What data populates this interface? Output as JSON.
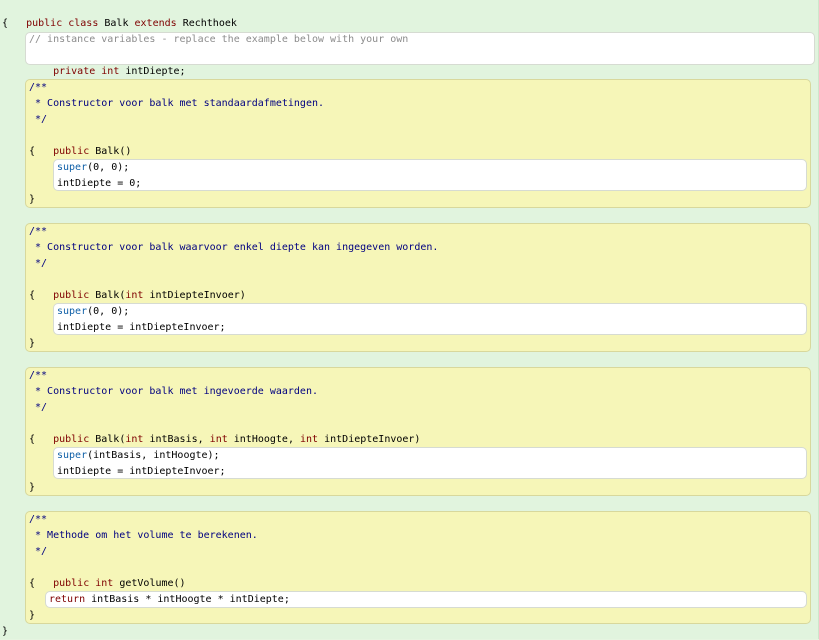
{
  "class_header": {
    "public": "public",
    "class": "class",
    "name": "Balk",
    "extends": "extends",
    "parent": "Rechthoek",
    "open_brace": "{"
  },
  "fields": {
    "comment": "// instance variables - replace the example below with your own",
    "private": "private",
    "type": "int",
    "name": "intDiepte;"
  },
  "methods": [
    {
      "doc": [
        "/**",
        " * Constructor voor balk met standaardafmetingen.",
        " */"
      ],
      "sig_public": "public",
      "sig_name": "Balk()",
      "open": "{",
      "body": [
        {
          "kw": "super",
          "rest": "(0, 0);"
        },
        {
          "kw": "",
          "rest": "intDiepte = 0;"
        }
      ],
      "close": "}"
    },
    {
      "doc": [
        "/**",
        " * Constructor voor balk waarvoor enkel diepte kan ingegeven worden.",
        " */"
      ],
      "sig_public": "public",
      "sig_name": "Balk(",
      "sig_type1": "int",
      "sig_rest1": "intDiepteInvoer)",
      "open": "{",
      "body": [
        {
          "kw": "super",
          "rest": "(0, 0);"
        },
        {
          "kw": "",
          "rest": "intDiepte = intDiepteInvoer;"
        }
      ],
      "close": "}"
    },
    {
      "doc": [
        "/**",
        " * Constructor voor balk met ingevoerde waarden.",
        " */"
      ],
      "sig_public": "public",
      "sig_name": "Balk(",
      "sig_type1": "int",
      "sig_rest1": "intBasis,",
      "sig_type2": "int",
      "sig_rest2": "intHoogte,",
      "sig_type3": "int",
      "sig_rest3": "intDiepteInvoer)",
      "open": "{",
      "body": [
        {
          "kw": "super",
          "rest": "(intBasis, intHoogte);"
        },
        {
          "kw": "",
          "rest": "intDiepte = intDiepteInvoer;"
        }
      ],
      "close": "}"
    },
    {
      "doc": [
        "/**",
        " * Methode om het volume te berekenen.",
        " */"
      ],
      "sig_public": "public",
      "sig_type1": "int",
      "sig_name": "getVolume()",
      "open": "{",
      "body": [
        {
          "kw": "return",
          "rest": "intBasis * intHoogte * intDiepte;"
        }
      ],
      "close": "}"
    }
  ],
  "class_close": "}"
}
